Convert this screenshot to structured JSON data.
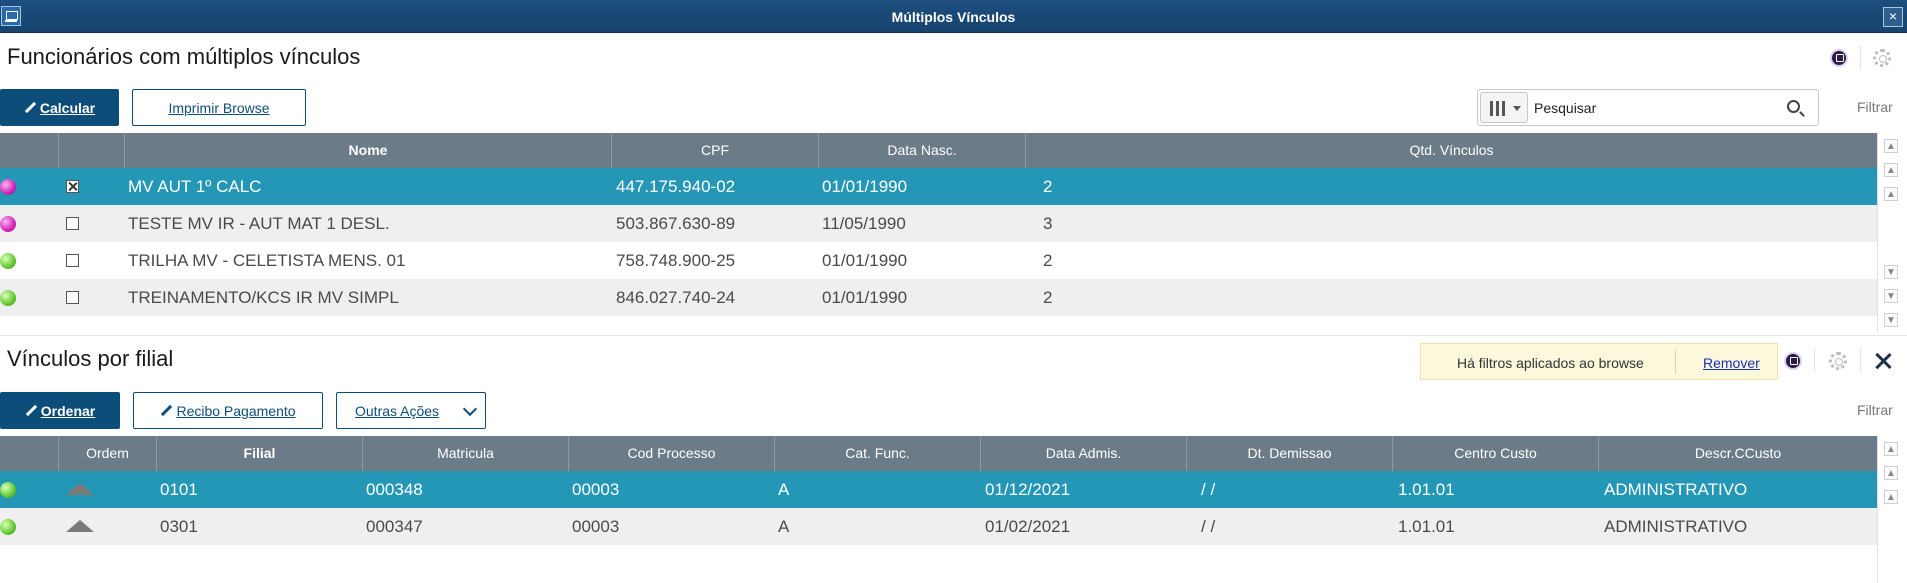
{
  "window": {
    "title": "Múltiplos Vínculos"
  },
  "top": {
    "section_title": "Funcionários com múltiplos vínculos",
    "buttons": {
      "calcular": "Calcular",
      "imprimir": "Imprimir Browse"
    },
    "search": {
      "placeholder": "Pesquisar"
    },
    "filter_label": "Filtrar",
    "columns": [
      "",
      "",
      "Nome",
      "CPF",
      "Data Nasc.",
      "Qtd. Vínculos"
    ],
    "rows": [
      {
        "status": "magenta",
        "checked": true,
        "nome": "MV AUT 1º CALC",
        "cpf": "447.175.940-02",
        "data_nasc": "01/01/1990",
        "qtd": "2",
        "selected": true
      },
      {
        "status": "magenta",
        "checked": false,
        "nome": "TESTE MV IR - AUT MAT 1 DESL.",
        "cpf": "503.867.630-89",
        "data_nasc": "11/05/1990",
        "qtd": "3",
        "selected": false
      },
      {
        "status": "green",
        "checked": false,
        "nome": "TRILHA MV - CELETISTA MENS. 01",
        "cpf": "758.748.900-25",
        "data_nasc": "01/01/1990",
        "qtd": "2",
        "selected": false
      },
      {
        "status": "green",
        "checked": false,
        "nome": "TREINAMENTO/KCS IR MV SIMPL",
        "cpf": "846.027.740-24",
        "data_nasc": "01/01/1990",
        "qtd": "2",
        "selected": false
      }
    ]
  },
  "bottom": {
    "section_title": "Vínculos por filial",
    "buttons": {
      "ordenar": "Ordenar",
      "recibo": "Recibo Pagamento",
      "outras": "Outras Ações"
    },
    "notice": {
      "message": "Há filtros aplicados ao browse",
      "remove_label": "Remover"
    },
    "filter_label": "Filtrar",
    "columns": [
      "",
      "Ordem",
      "Filial",
      "Matricula",
      "Cod Processo",
      "Cat. Func.",
      "Data Admis.",
      "Dt. Demissao",
      "Centro Custo",
      "Descr.CCusto"
    ],
    "rows": [
      {
        "status": "green",
        "filial": "0101",
        "matricula": "000348",
        "cod_processo": "00003",
        "cat_func": "A",
        "data_admis": "01/12/2021",
        "dt_demissao": "/ /",
        "centro_custo": "1.01.01",
        "descr_ccusto": "ADMINISTRATIVO",
        "selected": true
      },
      {
        "status": "green",
        "filial": "0301",
        "matricula": "000347",
        "cod_processo": "00003",
        "cat_func": "A",
        "data_admis": "01/02/2021",
        "dt_demissao": "/ /",
        "centro_custo": "1.01.01",
        "descr_ccusto": "ADMINISTRATIVO",
        "selected": false
      }
    ]
  },
  "colors": {
    "header": "#6b7b88",
    "selected_row": "#2496b6",
    "primary_button": "#0d4d7a",
    "title_bar": "#1e4e7e"
  }
}
